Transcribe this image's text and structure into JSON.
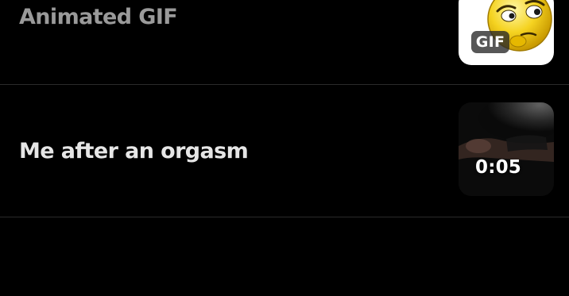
{
  "feed": {
    "items": [
      {
        "title": "Animated GIF",
        "media_badge": "GIF",
        "thumbnail_icon": "thinking-face-icon"
      },
      {
        "title": "Me after an orgasm",
        "duration": "0:05",
        "thumbnail_icon": "video-thumbnail"
      }
    ]
  },
  "colors": {
    "background": "#000000",
    "divider": "#2a2a2a",
    "title_muted": "#9a9a9a",
    "title_primary": "#e6e6e6"
  }
}
